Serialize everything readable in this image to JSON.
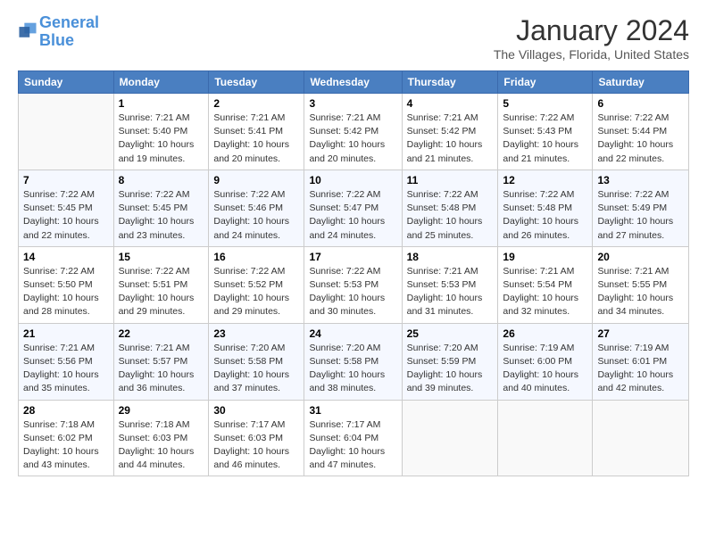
{
  "logo": {
    "line1": "General",
    "line2": "Blue"
  },
  "title": "January 2024",
  "subtitle": "The Villages, Florida, United States",
  "days_of_week": [
    "Sunday",
    "Monday",
    "Tuesday",
    "Wednesday",
    "Thursday",
    "Friday",
    "Saturday"
  ],
  "weeks": [
    [
      {
        "num": "",
        "info": ""
      },
      {
        "num": "1",
        "info": "Sunrise: 7:21 AM\nSunset: 5:40 PM\nDaylight: 10 hours\nand 19 minutes."
      },
      {
        "num": "2",
        "info": "Sunrise: 7:21 AM\nSunset: 5:41 PM\nDaylight: 10 hours\nand 20 minutes."
      },
      {
        "num": "3",
        "info": "Sunrise: 7:21 AM\nSunset: 5:42 PM\nDaylight: 10 hours\nand 20 minutes."
      },
      {
        "num": "4",
        "info": "Sunrise: 7:21 AM\nSunset: 5:42 PM\nDaylight: 10 hours\nand 21 minutes."
      },
      {
        "num": "5",
        "info": "Sunrise: 7:22 AM\nSunset: 5:43 PM\nDaylight: 10 hours\nand 21 minutes."
      },
      {
        "num": "6",
        "info": "Sunrise: 7:22 AM\nSunset: 5:44 PM\nDaylight: 10 hours\nand 22 minutes."
      }
    ],
    [
      {
        "num": "7",
        "info": "Sunrise: 7:22 AM\nSunset: 5:45 PM\nDaylight: 10 hours\nand 22 minutes."
      },
      {
        "num": "8",
        "info": "Sunrise: 7:22 AM\nSunset: 5:45 PM\nDaylight: 10 hours\nand 23 minutes."
      },
      {
        "num": "9",
        "info": "Sunrise: 7:22 AM\nSunset: 5:46 PM\nDaylight: 10 hours\nand 24 minutes."
      },
      {
        "num": "10",
        "info": "Sunrise: 7:22 AM\nSunset: 5:47 PM\nDaylight: 10 hours\nand 24 minutes."
      },
      {
        "num": "11",
        "info": "Sunrise: 7:22 AM\nSunset: 5:48 PM\nDaylight: 10 hours\nand 25 minutes."
      },
      {
        "num": "12",
        "info": "Sunrise: 7:22 AM\nSunset: 5:48 PM\nDaylight: 10 hours\nand 26 minutes."
      },
      {
        "num": "13",
        "info": "Sunrise: 7:22 AM\nSunset: 5:49 PM\nDaylight: 10 hours\nand 27 minutes."
      }
    ],
    [
      {
        "num": "14",
        "info": "Sunrise: 7:22 AM\nSunset: 5:50 PM\nDaylight: 10 hours\nand 28 minutes."
      },
      {
        "num": "15",
        "info": "Sunrise: 7:22 AM\nSunset: 5:51 PM\nDaylight: 10 hours\nand 29 minutes."
      },
      {
        "num": "16",
        "info": "Sunrise: 7:22 AM\nSunset: 5:52 PM\nDaylight: 10 hours\nand 29 minutes."
      },
      {
        "num": "17",
        "info": "Sunrise: 7:22 AM\nSunset: 5:53 PM\nDaylight: 10 hours\nand 30 minutes."
      },
      {
        "num": "18",
        "info": "Sunrise: 7:21 AM\nSunset: 5:53 PM\nDaylight: 10 hours\nand 31 minutes."
      },
      {
        "num": "19",
        "info": "Sunrise: 7:21 AM\nSunset: 5:54 PM\nDaylight: 10 hours\nand 32 minutes."
      },
      {
        "num": "20",
        "info": "Sunrise: 7:21 AM\nSunset: 5:55 PM\nDaylight: 10 hours\nand 34 minutes."
      }
    ],
    [
      {
        "num": "21",
        "info": "Sunrise: 7:21 AM\nSunset: 5:56 PM\nDaylight: 10 hours\nand 35 minutes."
      },
      {
        "num": "22",
        "info": "Sunrise: 7:21 AM\nSunset: 5:57 PM\nDaylight: 10 hours\nand 36 minutes."
      },
      {
        "num": "23",
        "info": "Sunrise: 7:20 AM\nSunset: 5:58 PM\nDaylight: 10 hours\nand 37 minutes."
      },
      {
        "num": "24",
        "info": "Sunrise: 7:20 AM\nSunset: 5:58 PM\nDaylight: 10 hours\nand 38 minutes."
      },
      {
        "num": "25",
        "info": "Sunrise: 7:20 AM\nSunset: 5:59 PM\nDaylight: 10 hours\nand 39 minutes."
      },
      {
        "num": "26",
        "info": "Sunrise: 7:19 AM\nSunset: 6:00 PM\nDaylight: 10 hours\nand 40 minutes."
      },
      {
        "num": "27",
        "info": "Sunrise: 7:19 AM\nSunset: 6:01 PM\nDaylight: 10 hours\nand 42 minutes."
      }
    ],
    [
      {
        "num": "28",
        "info": "Sunrise: 7:18 AM\nSunset: 6:02 PM\nDaylight: 10 hours\nand 43 minutes."
      },
      {
        "num": "29",
        "info": "Sunrise: 7:18 AM\nSunset: 6:03 PM\nDaylight: 10 hours\nand 44 minutes."
      },
      {
        "num": "30",
        "info": "Sunrise: 7:17 AM\nSunset: 6:03 PM\nDaylight: 10 hours\nand 46 minutes."
      },
      {
        "num": "31",
        "info": "Sunrise: 7:17 AM\nSunset: 6:04 PM\nDaylight: 10 hours\nand 47 minutes."
      },
      {
        "num": "",
        "info": ""
      },
      {
        "num": "",
        "info": ""
      },
      {
        "num": "",
        "info": ""
      }
    ]
  ]
}
